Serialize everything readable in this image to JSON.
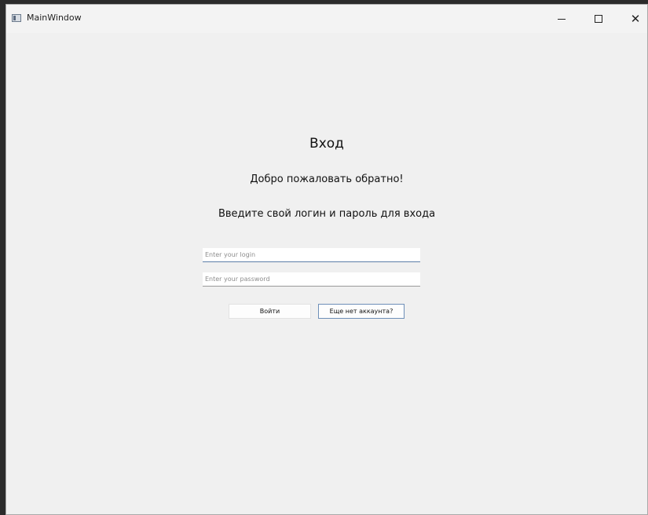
{
  "window": {
    "title": "MainWindow"
  },
  "titlebar_controls": {
    "minimize_icon": "minimize-icon",
    "maximize_icon": "maximize-icon",
    "close_icon": "close-icon"
  },
  "login_form": {
    "heading": "Вход",
    "welcome_text": "Добро пожаловать обратно!",
    "instruction_text": "Введите свой логин и пароль для входа",
    "login_field": {
      "value": "",
      "placeholder": "Enter your login"
    },
    "password_field": {
      "value": "",
      "placeholder": "Enter your password"
    },
    "login_button_label": "Войти",
    "register_button_label": "Еще нет аккаунта?"
  },
  "colors": {
    "window_background": "#f0f0f0",
    "focus_border": "#5d7fa8"
  }
}
